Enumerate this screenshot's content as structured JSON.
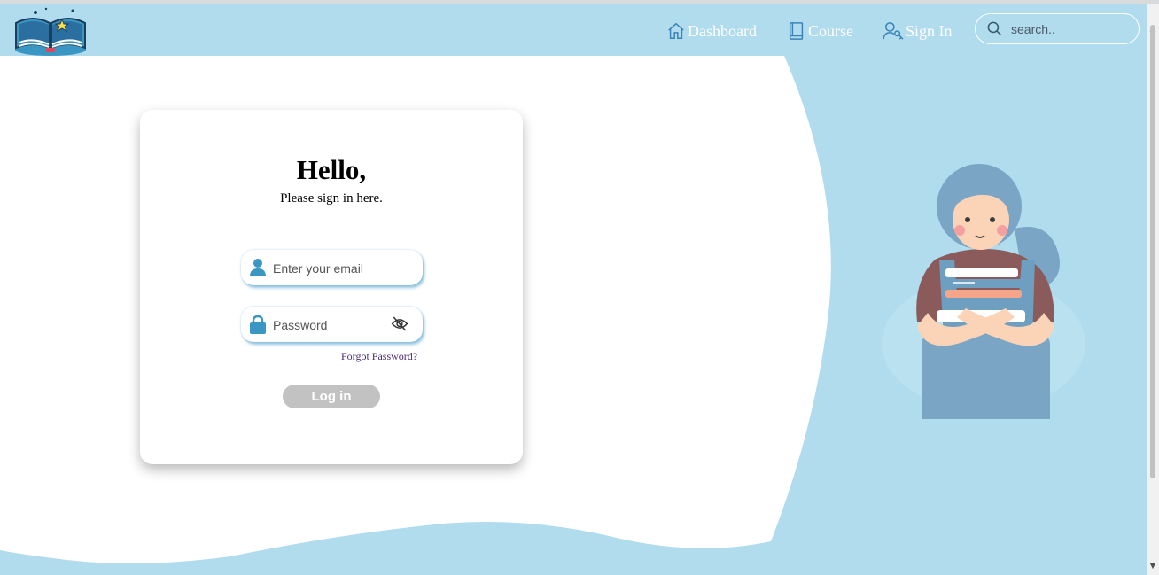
{
  "nav": {
    "logo_icon": "open-book-logo-icon",
    "links": [
      {
        "label": "Dashboard",
        "icon": "home-icon"
      },
      {
        "label": "Course",
        "icon": "book-icon"
      },
      {
        "label": "Sign In",
        "icon": "user-key-icon"
      }
    ],
    "search": {
      "placeholder": "search..",
      "icon": "search-icon"
    }
  },
  "login": {
    "title": "Hello,",
    "subtitle": "Please sign in here.",
    "email": {
      "value": "",
      "placeholder": "Enter your email",
      "icon": "user-icon"
    },
    "password": {
      "value": "",
      "placeholder": "Password",
      "icon": "lock-icon",
      "toggle_icon": "eye-slash-icon"
    },
    "forgot_label": "Forgot Password?",
    "login_label": "Log in"
  },
  "colors": {
    "brand_bg": "#b0dcee",
    "card_bg": "#ffffff",
    "icon_accent": "#3a97c4",
    "button_disabled": "#c2c2c2",
    "link": "#4b2b74"
  },
  "illustration": {
    "icon": "girl-holding-books-illustration"
  }
}
